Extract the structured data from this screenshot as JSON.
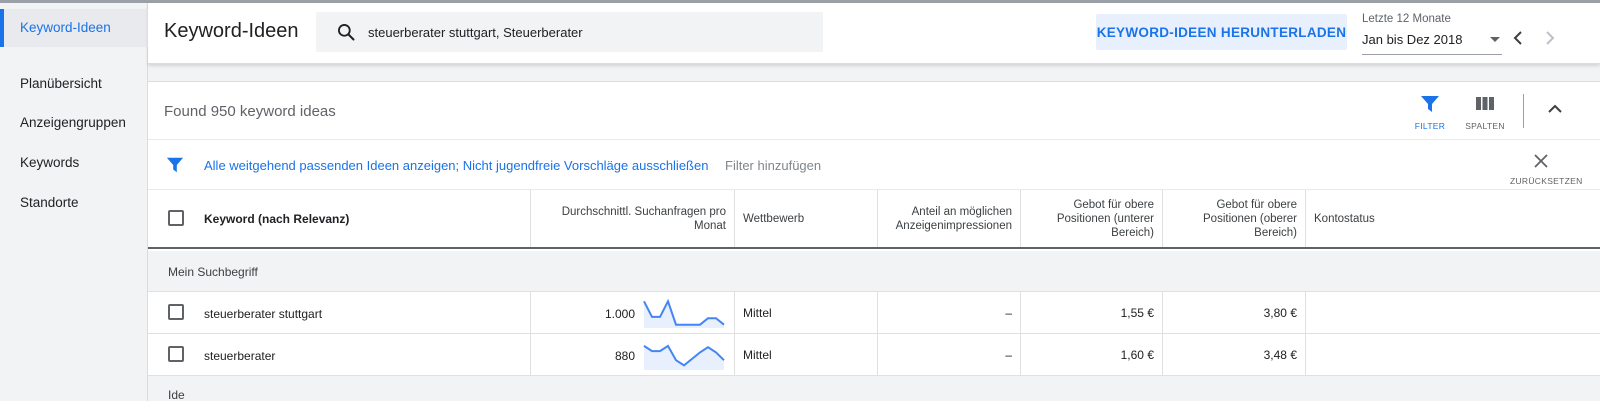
{
  "sidebar": {
    "items": [
      {
        "label": "Keyword-Ideen",
        "active": true
      },
      {
        "label": "Planübersicht"
      },
      {
        "label": "Anzeigengruppen"
      },
      {
        "label": "Keywords"
      },
      {
        "label": "Standorte"
      }
    ]
  },
  "header": {
    "title": "Keyword-Ideen",
    "search_value": "steuerberater stuttgart, Steuerberater",
    "download_label": "KEYWORD-IDEEN HERUNTERLADEN",
    "range_label": "Letzte 12 Monate",
    "range_value": "Jan bis Dez 2018"
  },
  "toolbar": {
    "found_text": "Found 950 keyword ideas",
    "filter_label": "FILTER",
    "columns_label": "SPALTEN"
  },
  "filters": {
    "active_filter": "Alle weitgehend passenden Ideen anzeigen; Nicht jugendfreie Vorschläge ausschließen",
    "add_filter": "Filter hinzufügen",
    "reset_label": "ZURÜCKSETZEN"
  },
  "table": {
    "columns": [
      "Keyword (nach Relevanz)",
      "Durchschnittl. Suchanfragen pro Monat",
      "Wettbewerb",
      "Anteil an möglichen Anzeigenimpressionen",
      "Gebot für obere Positionen (unterer Bereich)",
      "Gebot für obere Positionen (oberer Bereich)",
      "Kontostatus"
    ],
    "group_label": "Mein Suchbegriff",
    "rows": [
      {
        "keyword": "steuerberater stuttgart",
        "searches": "1.000",
        "trend": [
          0.95,
          0.35,
          0.35,
          0.95,
          0.05,
          0.05,
          0.05,
          0.05,
          0.3,
          0.3,
          0.05
        ],
        "competition": "Mittel",
        "impression_share": "–",
        "bid_low": "1,55 €",
        "bid_high": "3,80 €",
        "status": ""
      },
      {
        "keyword": "steuerberater",
        "searches": "880",
        "trend": [
          0.85,
          0.65,
          0.65,
          0.85,
          0.3,
          0.1,
          0.35,
          0.6,
          0.8,
          0.6,
          0.3
        ],
        "competition": "Mittel",
        "impression_share": "–",
        "bid_low": "1,60 €",
        "bid_high": "3,48 €",
        "status": ""
      }
    ],
    "next_group_label": "Ide"
  },
  "colors": {
    "accent": "#1a73e8",
    "sparkline": "#4285f4"
  }
}
